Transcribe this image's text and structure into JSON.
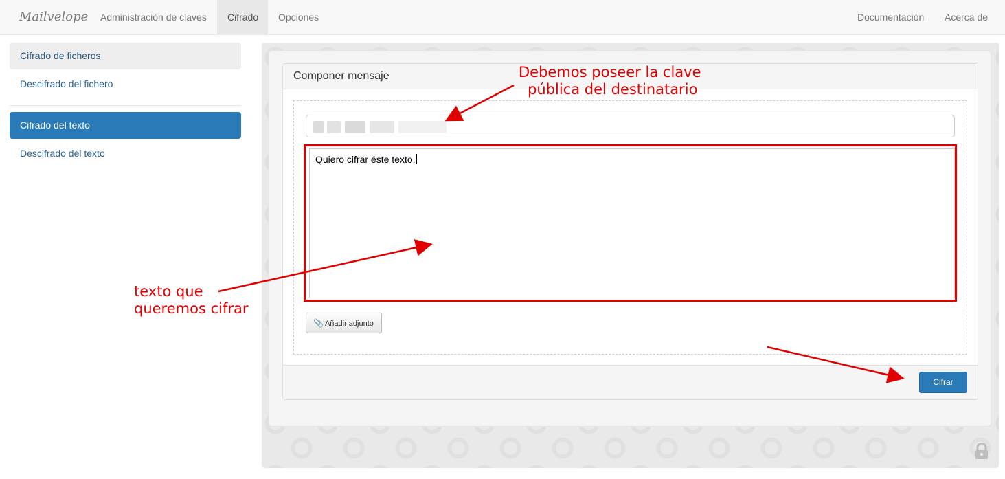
{
  "navbar": {
    "brand": "Mailvelope",
    "items": [
      {
        "label": "Administración de claves"
      },
      {
        "label": "Cifrado",
        "active": true
      },
      {
        "label": "Opciones"
      }
    ],
    "right_items": [
      {
        "label": "Documentación"
      },
      {
        "label": "Acerca de"
      }
    ]
  },
  "sidebar": {
    "file_items": [
      {
        "label": "Cifrado de ficheros",
        "selected": true
      },
      {
        "label": "Descifrado del fichero"
      }
    ],
    "text_items": [
      {
        "label": "Cifrado del texto",
        "active": true
      },
      {
        "label": "Descifrado del texto"
      }
    ]
  },
  "compose": {
    "heading": "Componer mensaje",
    "recipient_value": "",
    "message_text": "Quiero cifrar éste texto.",
    "attach_label": "Añadir adjunto",
    "encrypt_label": "Cifrar"
  },
  "annotations": {
    "key_note": [
      "Debemos poseer la clave",
      "pública del destinatario"
    ],
    "text_note": [
      "texto que",
      "queremos cifrar"
    ],
    "color": "#e00000"
  },
  "icons": {
    "attach": "paperclip-icon",
    "lock": "lock-icon"
  },
  "colors": {
    "primary": "#2a7ab8",
    "annotation": "#e00000"
  }
}
